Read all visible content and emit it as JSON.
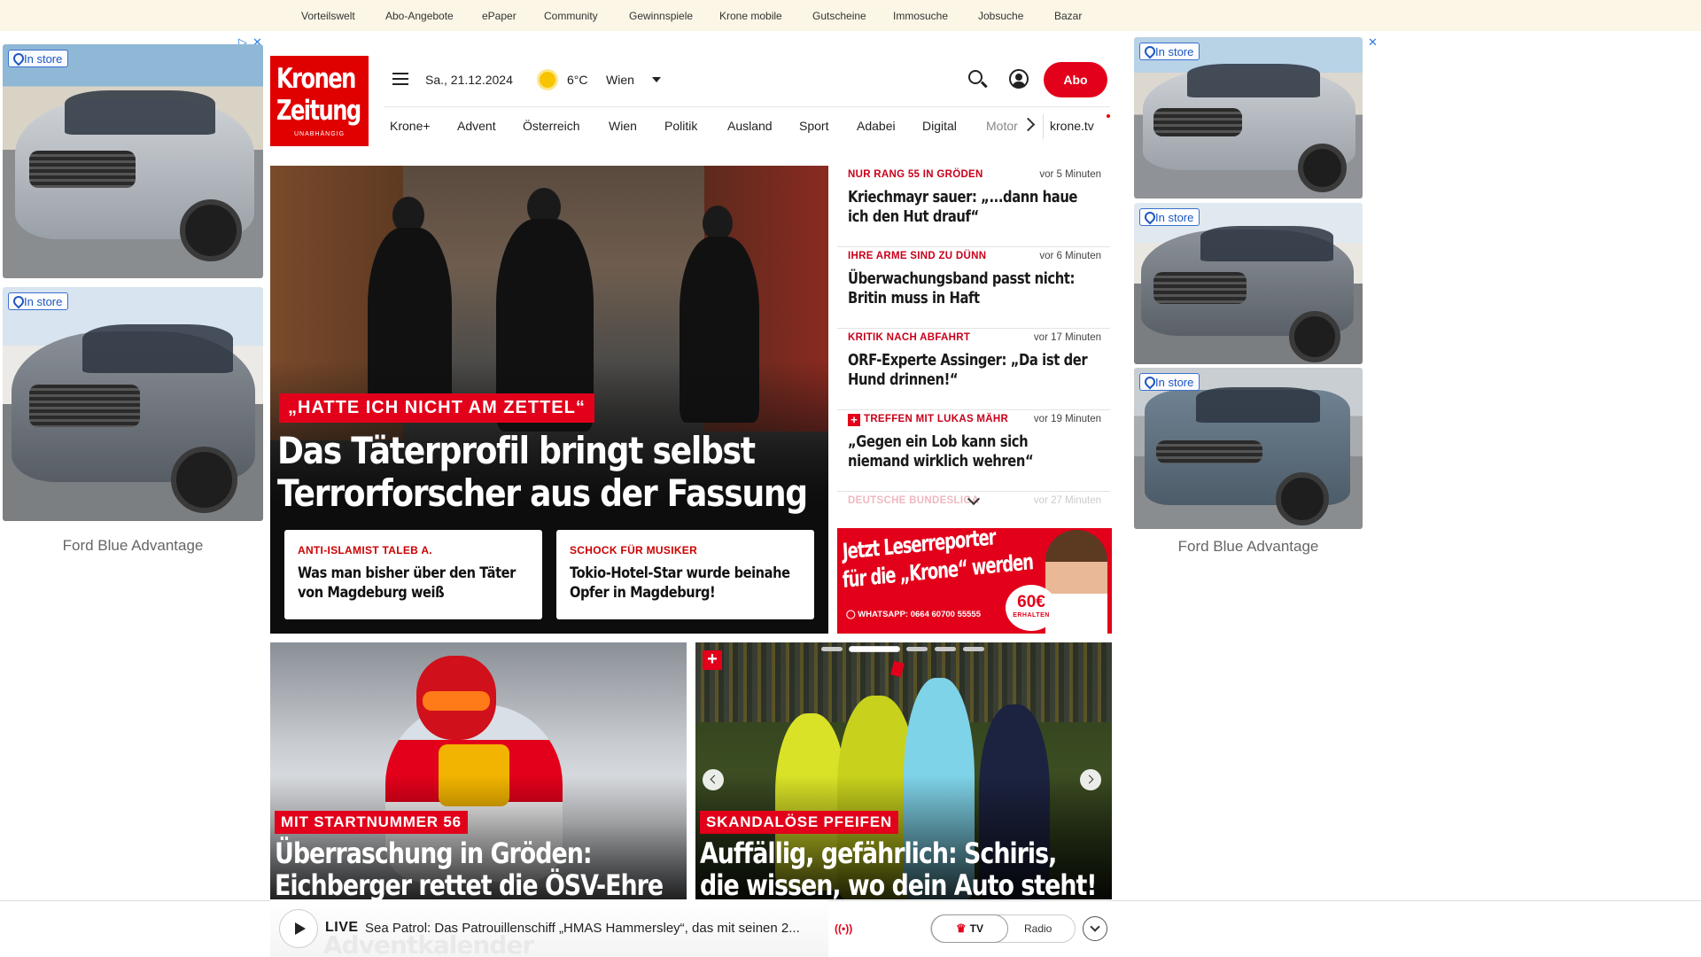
{
  "top_nav": [
    "Vorteilswelt",
    "Abo-Angebote",
    "ePaper",
    "Community",
    "Gewinnspiele",
    "Krone mobile",
    "Gutscheine",
    "Immosuche",
    "Jobsuche",
    "Bazar"
  ],
  "ads": {
    "badge": "In store",
    "left_caption": "Ford Blue Advantage",
    "right_caption": "Ford Blue Advantage",
    "close_glyph": "✕"
  },
  "header": {
    "logo_line1": "Kronen",
    "logo_line2": "Zeitung",
    "logo_tagline": "UNABHÄNGIG",
    "date": "Sa., 21.12.2024",
    "temperature": "6°C",
    "city": "Wien",
    "abo_label": "Abo",
    "icons": [
      "menu-icon",
      "sun-icon",
      "search-icon",
      "user-icon"
    ]
  },
  "nav": [
    "Krone+",
    "Advent",
    "Österreich",
    "Wien",
    "Politik",
    "Ausland",
    "Sport",
    "Adabei",
    "Digital",
    "Motor"
  ],
  "nav_extra": "krone.tv",
  "hero": {
    "kicker": "„HATTE ICH NICHT AM ZETTEL“",
    "title_line1": "Das Täterprofil bringt selbst",
    "title_line2": "Terrorforscher aus der Fassung",
    "sub": [
      {
        "kicker": "ANTI-ISLAMIST TALEB A.",
        "title": "Was man bisher über den Täter von Magdeburg weiß"
      },
      {
        "kicker": "SCHOCK FÜR MUSIKER",
        "title": "Tokio-Hotel-Star wurde beinahe Opfer in Magdeburg!"
      }
    ]
  },
  "ticker": [
    {
      "kicker": "NUR RANG 55 IN GRÖDEN",
      "time": "vor 5 Minuten",
      "title": "Kriechmayr sauer: „...dann haue ich den Hut drauf“",
      "plus": false
    },
    {
      "kicker": "IHRE ARME SIND ZU DÜNN",
      "time": "vor 6 Minuten",
      "title": "Überwachungsband passt nicht: Britin muss in Haft",
      "plus": false
    },
    {
      "kicker": "KRITIK NACH ABFAHRT",
      "time": "vor 17 Minuten",
      "title": "ORF-Experte Assinger: „Da ist der Hund drinnen!“",
      "plus": false
    },
    {
      "kicker": "TREFFEN MIT LUKAS MÄHR",
      "time": "vor 19 Minuten",
      "title": "„Gegen ein Lob kann sich niemand wirklich wehren“",
      "plus": true
    },
    {
      "kicker": "DEUTSCHE BUNDESLIGA",
      "time": "vor 27 Minuten",
      "title": "",
      "plus": false
    }
  ],
  "reporter": {
    "line1": "Jetzt Leserreporter",
    "line2": "für die „Krone“ werden",
    "whatsapp": "WHATSAPP: 0664 60700 55555",
    "amount": "60€",
    "amount_sub": "ERHALTEN"
  },
  "cards": [
    {
      "kicker": "MIT STARTNUMMER 56",
      "title_line1": "Überraschung in Gröden:",
      "title_line2": "Eichberger rettet die ÖSV-Ehre"
    },
    {
      "kicker": "SKANDALÖSE PFEIFEN",
      "title_line1": "Auffällig, gefährlich: Schiris,",
      "title_line2": "die wissen, wo dein Auto steht!"
    }
  ],
  "player": {
    "live": "LIVE",
    "text": "Sea Patrol: Das Patrouillenschiff „HMAS Hammersley“, das mit seinen 2...",
    "tv": "TV",
    "radio": "Radio",
    "background_text": "Adventkalender"
  },
  "colors": {
    "brand_red": "#e2001a",
    "topbar_bg": "#fbf6e6",
    "ad_link": "#1d56c4"
  }
}
